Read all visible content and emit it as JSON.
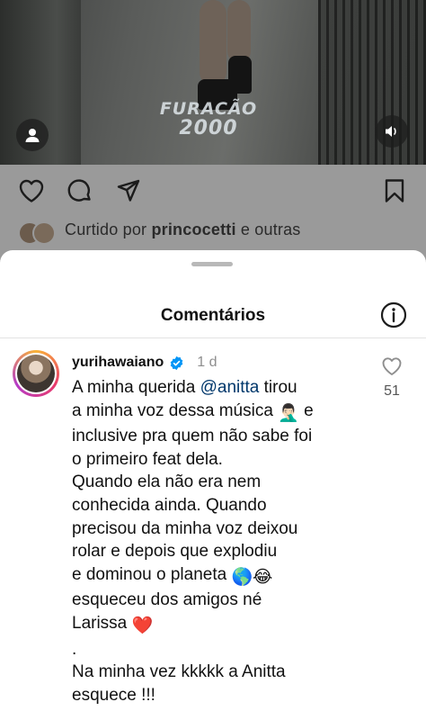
{
  "post": {
    "watermark_line1": "FURACÃO",
    "watermark_line2": "2000",
    "liked_by_prefix": "Curtido por ",
    "liked_by_user": "princocetti",
    "liked_by_suffix": " e outras"
  },
  "sheet": {
    "title": "Comentários"
  },
  "comment": {
    "username": "yurihawaiano",
    "time": "1 d",
    "like_count": "51",
    "lines": {
      "l1a": "A minha querida ",
      "l1mention": "@anitta",
      "l1b": " tirou",
      "l2": "a minha voz dessa música ",
      "l2b": " e",
      "l3": "inclusive pra quem não sabe foi",
      "l4": "o primeiro feat dela.",
      "l5": "Quando ela não era nem",
      "l6": "conhecida ainda. Quando",
      "l7": "precisou da minha voz deixou",
      "l8": "rolar e depois que explodiu",
      "l9": "e dominou o planeta ",
      "l10": "esqueceu dos amigos né",
      "l11": "Larissa ",
      "l12": ".",
      "l13": "Na minha vez kkkkk a Anitta",
      "l14": "esquece !!!"
    },
    "emojis": {
      "facepalm": "🤦🏻‍♂️",
      "globe": "🌎",
      "joy": "😂",
      "heart": "❤️"
    }
  },
  "colors": {
    "mention": "#00376b",
    "verified": "#0095f6"
  },
  "icons": [
    "user-icon",
    "speaker-icon",
    "heart-icon",
    "comment-icon",
    "share-icon",
    "bookmark-icon",
    "info-icon",
    "verified-icon",
    "like-heart-icon"
  ]
}
